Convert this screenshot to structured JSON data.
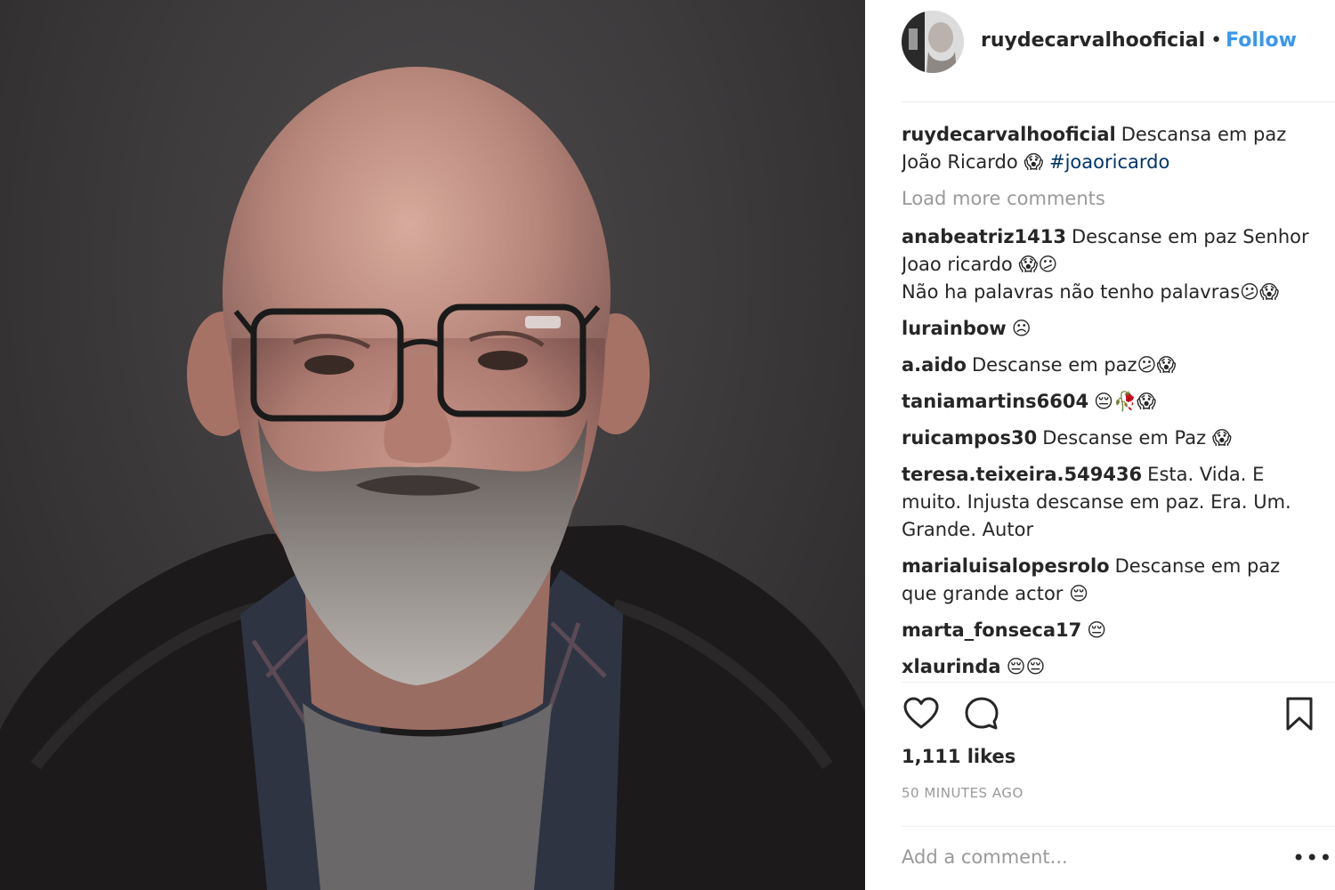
{
  "post": {
    "author": "ruydecarvalhooficial",
    "follow_label": "Follow",
    "separator": "•",
    "caption": {
      "user": "ruydecarvalhooficial",
      "text": "Descansa em paz João Ricardo 😱",
      "hashtag": "#joaoricardo"
    },
    "load_more": "Load more comments",
    "comments": [
      {
        "user": "anabeatriz1413",
        "text": "Descanse em paz Senhor Joao ricardo 😱😕\nNão ha palavras não tenho palavras😕😱"
      },
      {
        "user": "lurainbow",
        "text": "☹"
      },
      {
        "user": "a.aido",
        "text": "Descanse em paz😕😱"
      },
      {
        "user": "taniamartins6604",
        "text": "😔🥀😱"
      },
      {
        "user": "ruicampos30",
        "text": "Descanse em Paz 😱"
      },
      {
        "user": "teresa.teixeira.549436",
        "text": "Esta. Vida. E muito. Injusta descanse em paz. Era. Um. Grande. Autor"
      },
      {
        "user": "marialuisalopesrolo",
        "text": "Descanse em paz que grande actor 😔"
      },
      {
        "user": "marta_fonseca17",
        "text": "😔"
      },
      {
        "user": "xlaurinda",
        "text": "😔😔"
      }
    ],
    "likes": "1,111 likes",
    "time": "50 MINUTES AGO",
    "add_comment_placeholder": "Add a comment...",
    "more_options": "•••"
  },
  "icons": {
    "like": "heart-icon",
    "comment": "comment-bubble-icon",
    "save": "bookmark-icon",
    "more": "more-options-icon"
  },
  "colors": {
    "follow": "#3897f0",
    "hashtag": "#003569",
    "muted": "#999999",
    "text": "#262626"
  }
}
